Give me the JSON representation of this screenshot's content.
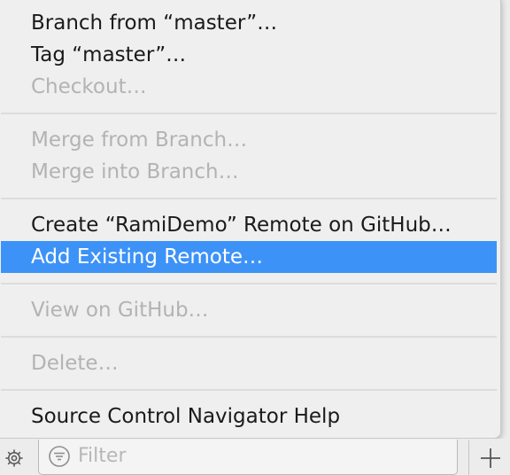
{
  "menu": {
    "items": [
      {
        "label": "Branch from “master”…",
        "enabled": true
      },
      {
        "label": "Tag “master”…",
        "enabled": true
      },
      {
        "label": "Checkout…",
        "enabled": false
      },
      {
        "label": "Merge from Branch…",
        "enabled": false
      },
      {
        "label": "Merge into Branch…",
        "enabled": false
      },
      {
        "label": "Create “RamiDemo” Remote on GitHub…",
        "enabled": true
      },
      {
        "label": "Add Existing Remote…",
        "enabled": true,
        "highlighted": true
      },
      {
        "label": "View on GitHub…",
        "enabled": false
      },
      {
        "label": "Delete…",
        "enabled": false
      },
      {
        "label": "Source Control Navigator Help",
        "enabled": true
      }
    ]
  },
  "bottom_bar": {
    "settings_icon": "gear-icon",
    "filter_icon": "filter-icon",
    "filter_placeholder": "Filter",
    "filter_value": "",
    "add_icon": "plus-icon"
  },
  "colors": {
    "highlight": "#3d92f7",
    "text": "#1a1a1a",
    "disabled_text": "#b3b3b3",
    "menu_background": "#efefef"
  }
}
